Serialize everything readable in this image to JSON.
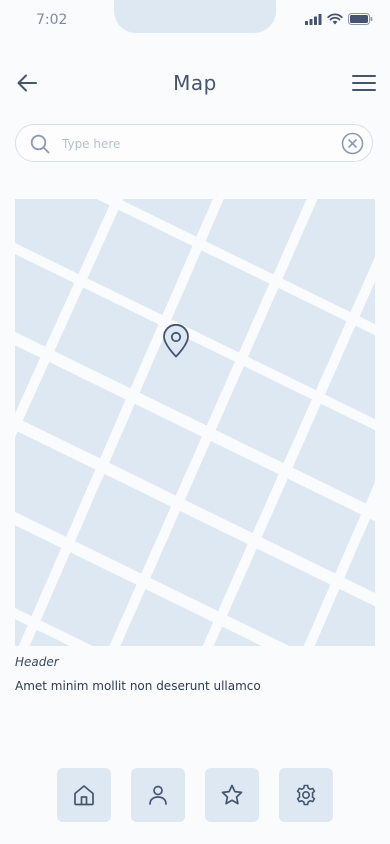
{
  "status_bar": {
    "time": "7:02",
    "icons": [
      "signal-icon",
      "wifi-icon",
      "battery-icon"
    ]
  },
  "header": {
    "title": "Map",
    "back_icon": "arrow-left-icon",
    "menu_icon": "hamburger-menu-icon"
  },
  "search": {
    "placeholder": "Type here",
    "value": "",
    "icon": "search-icon",
    "clear_icon": "clear-circle-x-icon"
  },
  "map": {
    "marker_icon": "location-pin-icon"
  },
  "caption": {
    "header": "Header",
    "text": "Amet minim mollit non deserunt ullamco"
  },
  "bottom_nav": {
    "items": [
      {
        "icon": "home-icon"
      },
      {
        "icon": "user-icon"
      },
      {
        "icon": "star-icon"
      },
      {
        "icon": "settings-gear-icon"
      }
    ]
  },
  "colors": {
    "background": "#fafbfd",
    "tile": "#dde8f3",
    "icon": "#46556f",
    "text": "#46556f"
  }
}
